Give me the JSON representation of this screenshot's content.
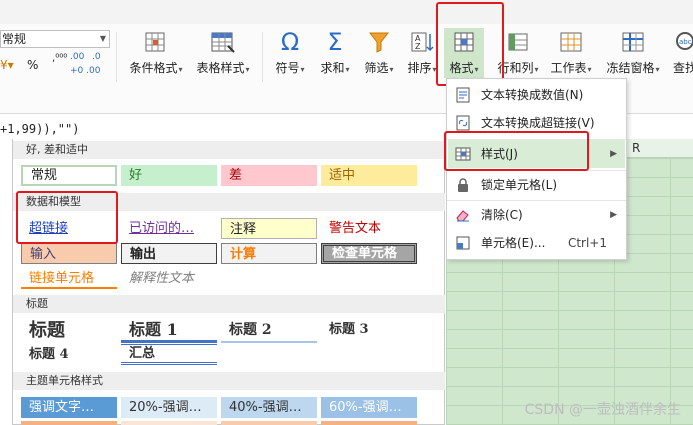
{
  "number_format": {
    "value": "常规"
  },
  "quick_buttons": {
    "currency": "%",
    "percent": "%",
    "comma": ",",
    "inc_decimal": ".00",
    "dec_decimal": ".0"
  },
  "ribbon": {
    "conditional_format": "条件格式",
    "table_style": "表格样式",
    "symbol": "符号",
    "sum": "求和",
    "filter": "筛选",
    "sort": "排序",
    "format": "格式",
    "row_col": "行和列",
    "worksheet": "工作表",
    "freeze": "冻结窗格",
    "find": "查找"
  },
  "formula": {
    "text": "+1,99)),\"\")"
  },
  "sheet": {
    "col_label": "R"
  },
  "gallery": {
    "sections": [
      {
        "title": "好, 差和适中",
        "styles": [
          "常规",
          "好",
          "差",
          "适中"
        ]
      },
      {
        "title": "数据和模型",
        "styles": [
          "超链接",
          "已访问的…",
          "注释",
          "警告文本",
          "输入",
          "输出",
          "计算",
          "检查单元格",
          "链接单元格",
          "解释性文本"
        ]
      },
      {
        "title": "标题",
        "styles": [
          "标题",
          "标题 1",
          "标题 2",
          "标题 3",
          "标题 4",
          "汇总"
        ]
      },
      {
        "title": "主题单元格样式",
        "styles": [
          "强调文字…",
          "20%-强调…",
          "40%-强调…",
          "60%-强调…"
        ]
      }
    ]
  },
  "menu": {
    "items": [
      {
        "label": "文本转换成数值(N)",
        "icon": "convert-number-icon"
      },
      {
        "label": "文本转换成超链接(V)",
        "icon": "convert-link-icon"
      },
      {
        "label": "样式(J)",
        "icon": "style-icon",
        "submenu": true
      },
      {
        "label": "锁定单元格(L)",
        "icon": "lock-icon"
      },
      {
        "label": "清除(C)",
        "icon": "eraser-icon",
        "submenu": true
      },
      {
        "label": "单元格(E)...",
        "icon": "cell-icon",
        "shortcut": "Ctrl+1"
      }
    ]
  },
  "watermark": "CSDN @一壶浊酒伴余生",
  "colors": {
    "highlight_red": "#e0191f",
    "menu_hover": "#d8ecd6",
    "accent_blue": "#2b6cc4"
  }
}
